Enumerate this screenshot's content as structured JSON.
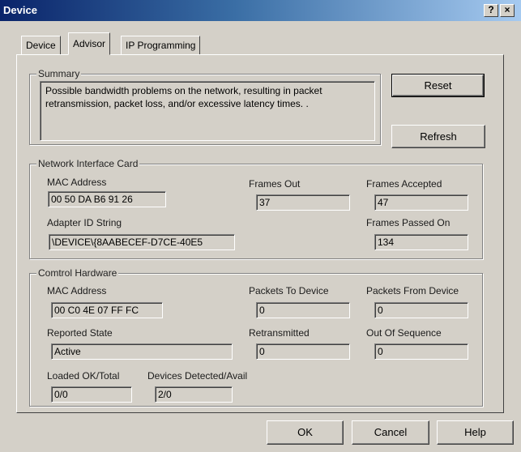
{
  "window": {
    "title": "Device",
    "help_label": "?",
    "close_label": "×"
  },
  "tabs": [
    {
      "label": "Device"
    },
    {
      "label": "Advisor",
      "active": true
    },
    {
      "label": "IP Programming"
    }
  ],
  "summary": {
    "legend": "Summary",
    "text": "Possible bandwidth problems on the network, resulting in packet retransmission, packet loss, and/or excessive latency times. .",
    "reset_label": "Reset",
    "refresh_label": "Refresh"
  },
  "nic": {
    "legend": "Network Interface Card",
    "mac_label": "MAC Address",
    "mac_value": "00 50 DA B6 91 26",
    "frames_out_label": "Frames Out",
    "frames_out_value": "37",
    "frames_accepted_label": "Frames Accepted",
    "frames_accepted_value": "47",
    "adapter_id_label": "Adapter ID String",
    "adapter_id_value": "\\DEVICE\\{8AABECEF-D7CE-40E5",
    "frames_passed_label": "Frames Passed On",
    "frames_passed_value": "134"
  },
  "hardware": {
    "legend": "Comtrol Hardware",
    "mac_label": "MAC Address",
    "mac_value": "00 C0 4E 07 FF FC",
    "packets_to_label": "Packets To Device",
    "packets_to_value": "0",
    "packets_from_label": "Packets From Device",
    "packets_from_value": "0",
    "state_label": "Reported State",
    "state_value": "Active",
    "retransmitted_label": "Retransmitted",
    "retransmitted_value": "0",
    "out_of_seq_label": "Out Of Sequence",
    "out_of_seq_value": "0",
    "loaded_label": "Loaded OK/Total",
    "loaded_value": "0/0",
    "detected_label": "Devices Detected/Avail",
    "detected_value": "2/0"
  },
  "footer": {
    "ok_label": "OK",
    "cancel_label": "Cancel",
    "help_label": "Help"
  }
}
